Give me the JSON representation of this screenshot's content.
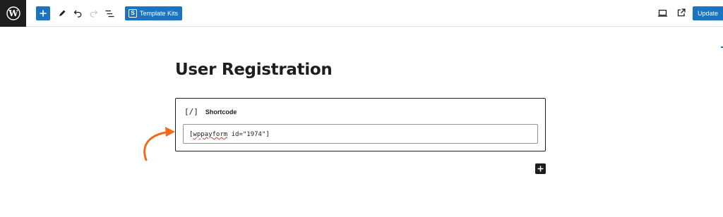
{
  "toolbar": {
    "add_block_label": "Add block",
    "template_kits_label": "Template Kits",
    "template_kits_badge": "S",
    "update_label": "Update",
    "icons": [
      "wordpress-logo-icon",
      "plus-icon",
      "pencil-icon",
      "undo-icon",
      "redo-icon",
      "list-view-icon",
      "desktop-preview-icon",
      "external-link-icon"
    ],
    "accent_color": "#1e73be"
  },
  "content": {
    "page_title": "User Registration",
    "shortcode_block": {
      "icon_text": "[/]",
      "label": "Shortcode",
      "value_tag": "wppayform",
      "value_rest": " id=\"1974\"]",
      "value_prefix": "["
    },
    "annotation_arrow_color": "#f26b1d"
  }
}
